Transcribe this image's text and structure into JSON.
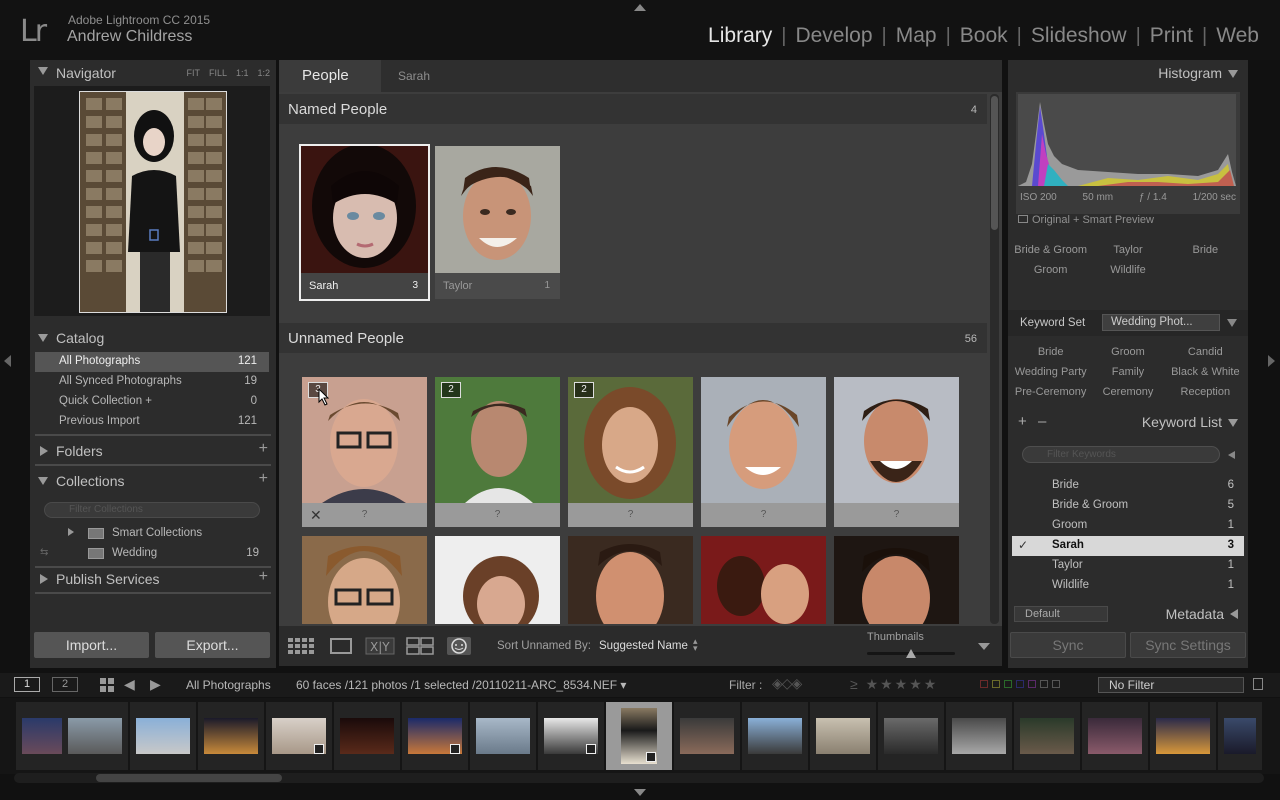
{
  "app": {
    "logo": "Lr",
    "name": "Adobe Lightroom CC 2015",
    "user": "Andrew Childress"
  },
  "modules": [
    "Library",
    "Develop",
    "Map",
    "Book",
    "Slideshow",
    "Print",
    "Web"
  ],
  "active_module": "Library",
  "left": {
    "navigator": {
      "title": "Navigator",
      "zoom": [
        "FIT",
        "FILL",
        "1:1",
        "1:2"
      ]
    },
    "catalog": {
      "title": "Catalog",
      "items": [
        {
          "label": "All Photographs",
          "count": "121"
        },
        {
          "label": "All Synced Photographs",
          "count": "19"
        },
        {
          "label": "Quick Collection +",
          "count": "0"
        },
        {
          "label": "Previous Import",
          "count": "121"
        }
      ]
    },
    "folders": {
      "title": "Folders"
    },
    "collections": {
      "title": "Collections",
      "filter_placeholder": "Filter Collections",
      "items": [
        {
          "label": "Smart Collections",
          "count": ""
        },
        {
          "label": "Wedding",
          "count": "19"
        }
      ]
    },
    "publish": {
      "title": "Publish Services"
    },
    "import_label": "Import...",
    "export_label": "Export..."
  },
  "center": {
    "tabs": {
      "people": "People",
      "sarah": "Sarah"
    },
    "named": {
      "title": "Named People",
      "count": "4",
      "people": [
        {
          "name": "Sarah",
          "count": "3"
        },
        {
          "name": "Taylor",
          "count": "1"
        }
      ]
    },
    "unnamed": {
      "title": "Unnamed People",
      "count": "56",
      "faces": [
        {
          "badge": "3",
          "label": "?"
        },
        {
          "badge": "2",
          "label": "?"
        },
        {
          "badge": "2",
          "label": "?"
        },
        {
          "badge": "",
          "label": "?"
        },
        {
          "badge": "",
          "label": "?"
        }
      ]
    }
  },
  "toolbar": {
    "sort_label": "Sort Unnamed By:",
    "sort_value": "Suggested Name",
    "thumbnails_label": "Thumbnails",
    "thumbnail_size": 0.5
  },
  "right": {
    "histogram": {
      "title": "Histogram",
      "iso": "ISO 200",
      "focal": "50 mm",
      "aperture": "ƒ / 1.4",
      "shutter": "1/200 sec",
      "preview": "Original + Smart Preview"
    },
    "suggestions": [
      "Bride & Groom",
      "Taylor",
      "Bride",
      "Groom",
      "Wildlife",
      ""
    ],
    "keyword_set": {
      "label": "Keyword Set",
      "value": "Wedding Phot...",
      "keywords": [
        "Bride",
        "Groom",
        "Candid",
        "Wedding Party",
        "Family",
        "Black & White",
        "Pre-Ceremony",
        "Ceremony",
        "Reception"
      ]
    },
    "keyword_list": {
      "title": "Keyword List",
      "filter_placeholder": "Filter Keywords",
      "items": [
        {
          "label": "Bride",
          "count": "6"
        },
        {
          "label": "Bride & Groom",
          "count": "5"
        },
        {
          "label": "Groom",
          "count": "1"
        },
        {
          "label": "Sarah",
          "count": "3"
        },
        {
          "label": "Taylor",
          "count": "1"
        },
        {
          "label": "Wildlife",
          "count": "1"
        }
      ]
    },
    "metadata": {
      "preset": "Default",
      "title": "Metadata"
    },
    "sync_label": "Sync",
    "sync_settings_label": "Sync Settings"
  },
  "filmbar": {
    "screen1": "1",
    "screen2": "2",
    "source": "All Photographs",
    "info": "60 faces /121 photos /1 selected /20110211-ARC_8534.NEF ▾",
    "filter_label": "Filter :",
    "filter_value": "No Filter"
  },
  "colors": {
    "accent": "#e6e6e6",
    "panel": "#2c2c2c",
    "center": "#3d3d3d"
  }
}
